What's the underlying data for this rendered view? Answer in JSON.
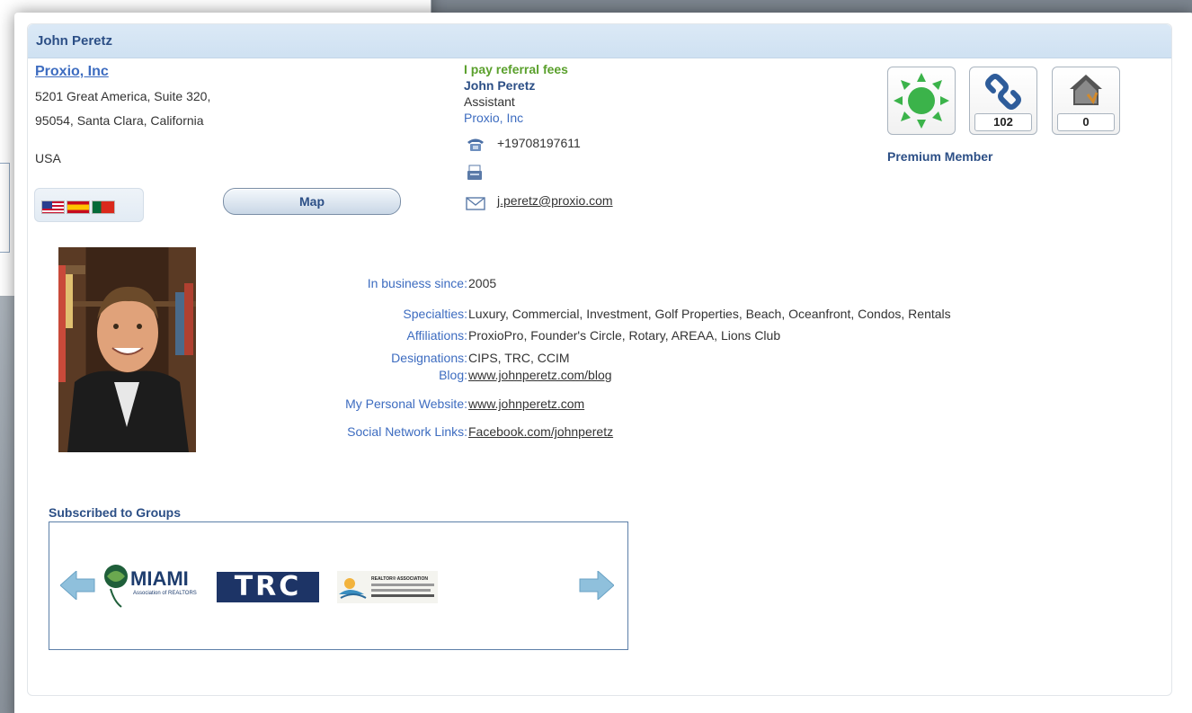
{
  "profile": {
    "name": "John Peretz",
    "company": "Proxio, Inc",
    "address_line1": "5201 Great America, Suite 320,",
    "address_line2": "95054, Santa Clara, California",
    "country": "USA",
    "map_label": "Map"
  },
  "contact": {
    "referral": "I pay referral fees",
    "name": "John Peretz",
    "role": "Assistant",
    "company": "Proxio, Inc",
    "phone": "+19708197611",
    "email": "j.peretz@proxio.com"
  },
  "badges": [
    {
      "icon": "sun-icon",
      "count": ""
    },
    {
      "icon": "link-icon",
      "count": "102"
    },
    {
      "icon": "house-icon",
      "count": "0"
    }
  ],
  "membership": "Premium Member",
  "details": [
    {
      "label": "In business since:",
      "value": "2005",
      "link": false
    },
    {
      "label": "Specialties:",
      "value": "Luxury, Commercial, Investment, Golf Properties, Beach, Oceanfront, Condos, Rentals",
      "link": false
    },
    {
      "label": "Affiliations:",
      "value": "ProxioPro, Founder's Circle, Rotary, AREAA, Lions Club",
      "link": false
    },
    {
      "label": "Designations:",
      "value": "CIPS, TRC, CCIM",
      "link": false
    },
    {
      "label": "Blog:",
      "value": "www.johnperetz.com/blog",
      "link": true
    },
    {
      "label": "My Personal Website:",
      "value": "www.johnperetz.com",
      "link": true
    },
    {
      "label": "Social Network Links:",
      "value": "Facebook.com/johnperetz",
      "link": true
    }
  ],
  "groups": {
    "title": "Subscribed to Groups",
    "logos": [
      {
        "name": "MIAMI",
        "sub": "Association of REALTORS"
      },
      {
        "name": "TRC"
      },
      {
        "name": "REALTOR® ASSOCIATION"
      }
    ]
  },
  "colors": {
    "accent": "#2c4f86",
    "link": "#3d6cc0",
    "referral": "#5aa02c",
    "header_bg": "#d6e6f5"
  }
}
